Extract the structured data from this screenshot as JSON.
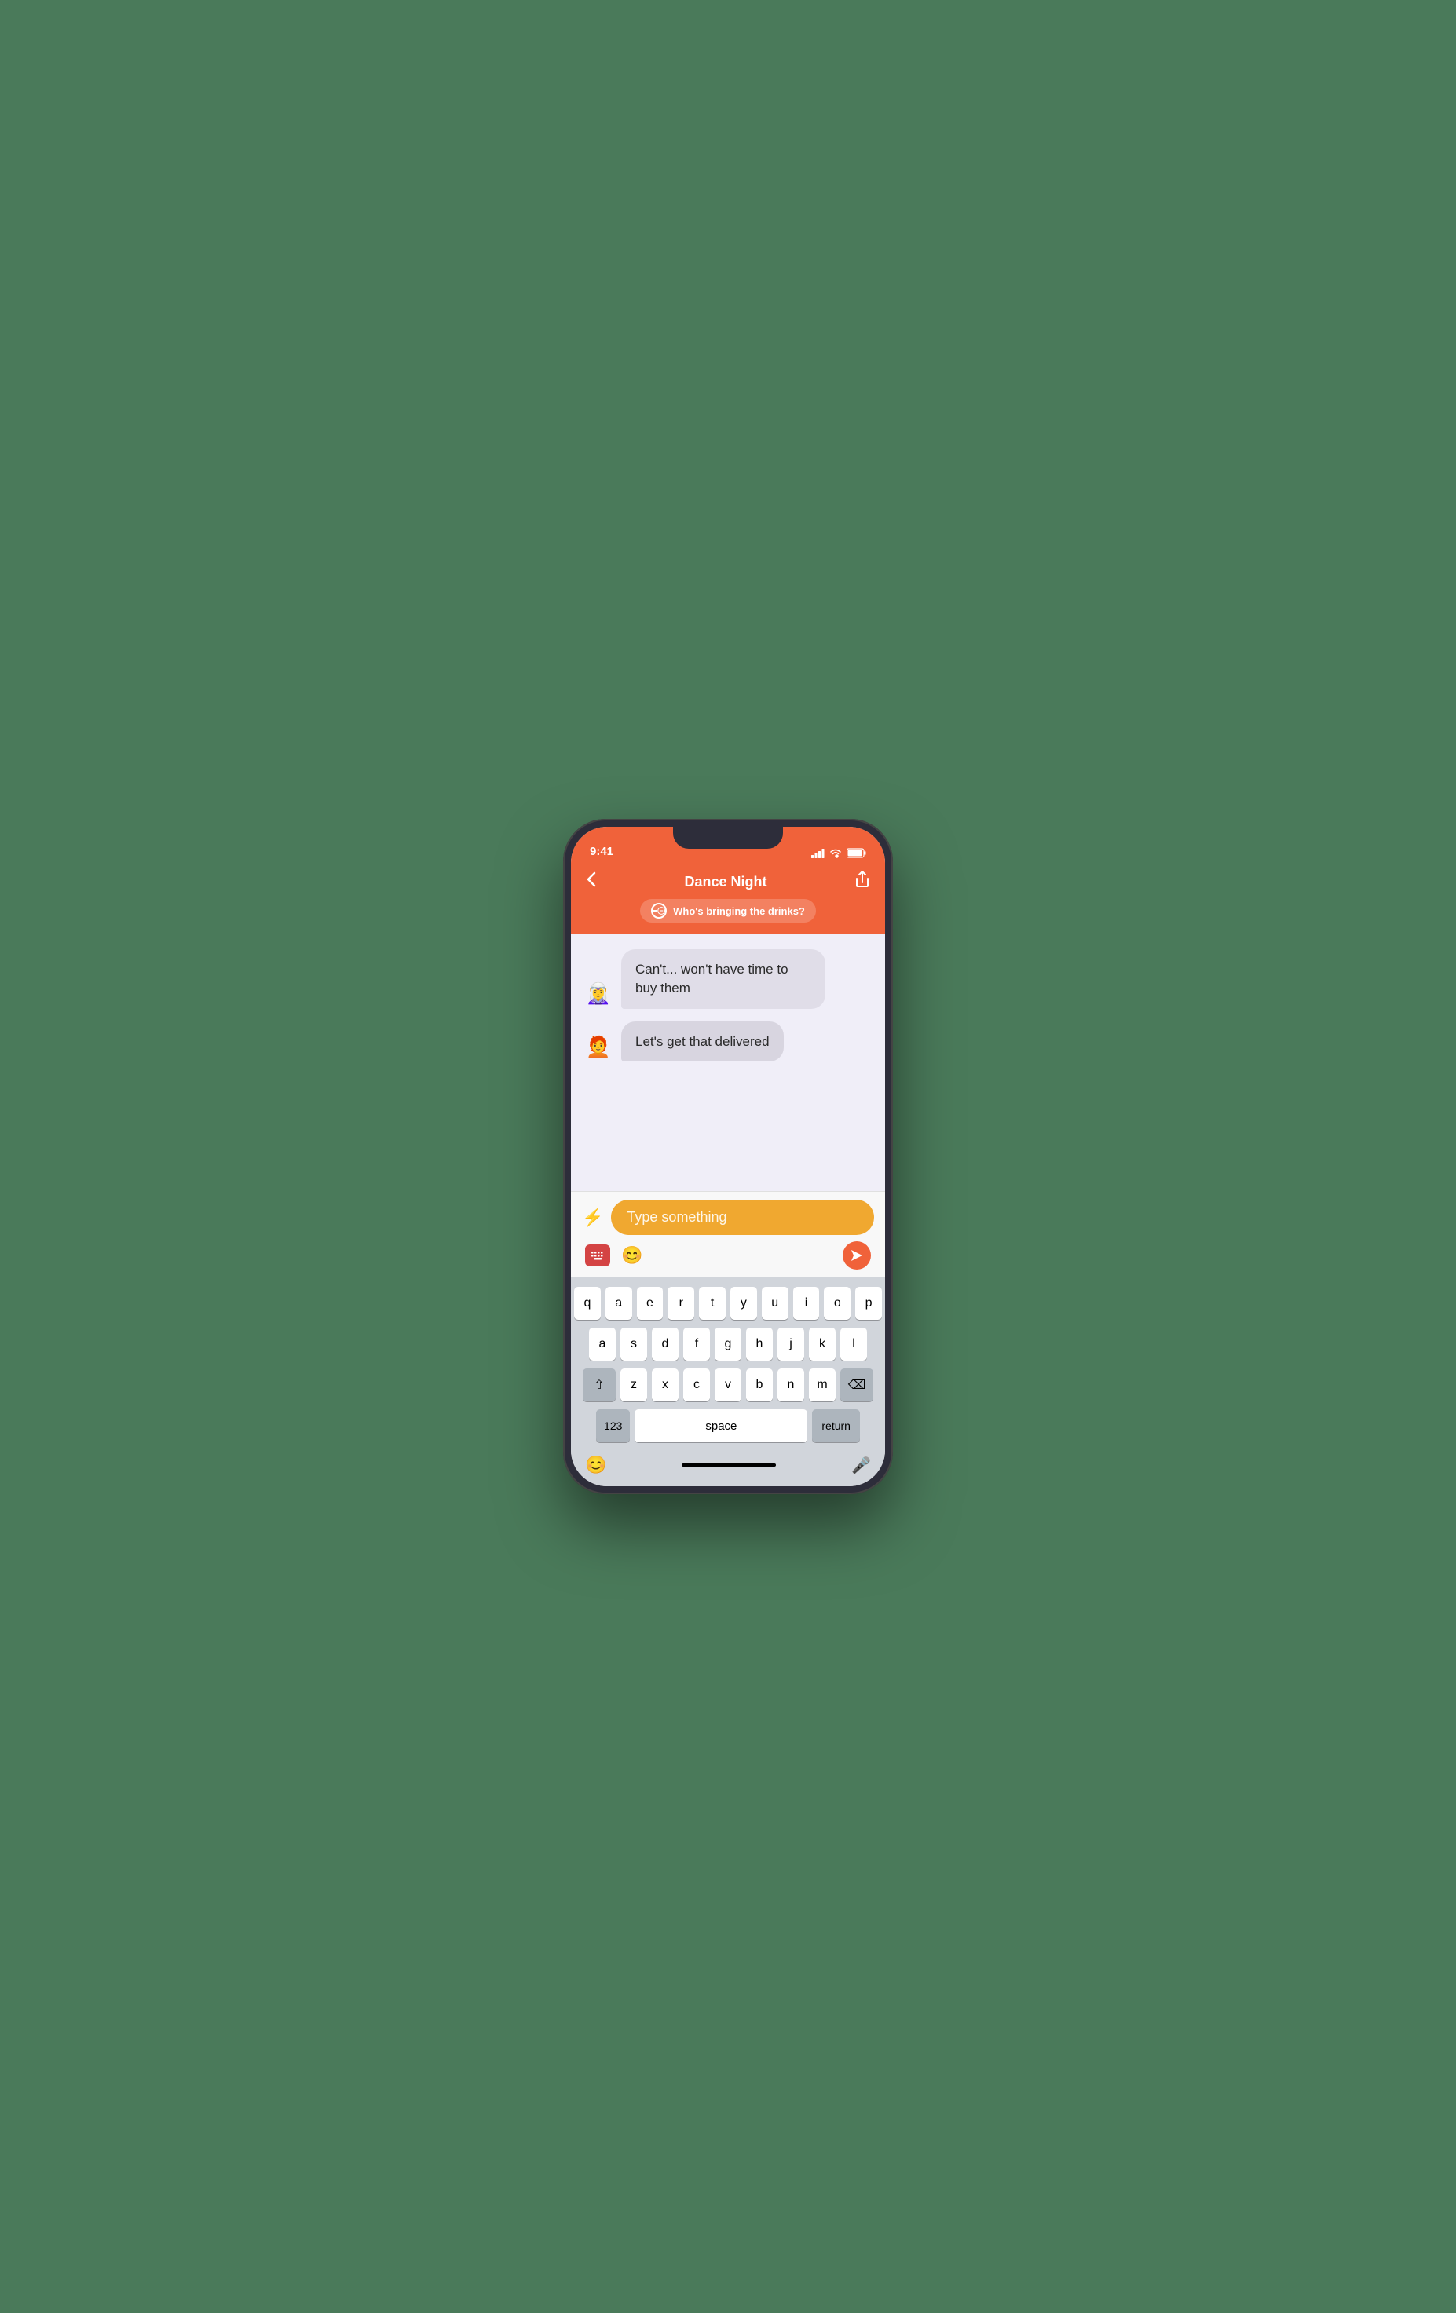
{
  "status": {
    "time": "9:41",
    "signal_icon": "signal-icon",
    "wifi_icon": "wifi-icon",
    "battery_icon": "battery-icon"
  },
  "header": {
    "back_label": "‹",
    "title": "Dance Night",
    "share_label": "↑",
    "topic_icon": "topic-icon",
    "topic_text": "Who's bringing the drinks?"
  },
  "messages": [
    {
      "avatar_emoji": "🧝",
      "text": "Can't... won't have time to buy them"
    },
    {
      "avatar_emoji": "🧑",
      "text": "Let's get that delivered"
    }
  ],
  "input": {
    "lightning_icon": "⚡",
    "placeholder": "Type something",
    "keyboard_icon": "keyboard-icon",
    "emoji_icon": "😊",
    "send_icon": "send-icon"
  },
  "keyboard": {
    "row1": [
      "q",
      "a",
      "e",
      "r",
      "t",
      "y",
      "u",
      "i",
      "o",
      "p"
    ],
    "row2": [
      "a",
      "s",
      "d",
      "f",
      "g",
      "h",
      "j",
      "k",
      "l"
    ],
    "row3": [
      "z",
      "x",
      "c",
      "v",
      "b",
      "n",
      "m"
    ],
    "space_label": "space",
    "return_label": "return",
    "num_label": "123",
    "shift_icon": "shift-icon",
    "delete_icon": "delete-icon",
    "emoji_bottom": "😊",
    "mic_icon": "mic-icon"
  },
  "colors": {
    "header_bg": "#f0623a",
    "chat_bg": "#f0eef8",
    "bubble1": "#e0dde8",
    "bubble2": "#d8d5e0",
    "input_bg": "#f0a830",
    "send_btn": "#f0623a"
  }
}
